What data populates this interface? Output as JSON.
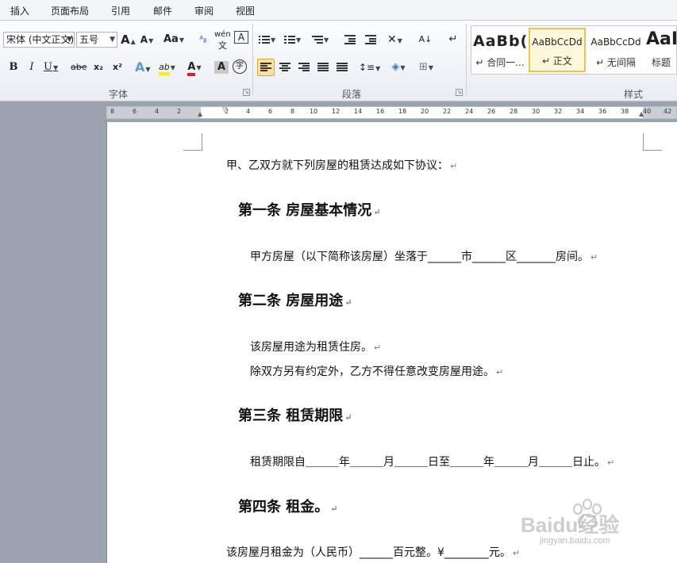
{
  "menu": {
    "tabs": [
      "插入",
      "页面布局",
      "引用",
      "邮件",
      "审阅",
      "视图"
    ]
  },
  "font_group": {
    "font_name": "宋体 (中文正文)",
    "font_size": "五号",
    "grow": "A",
    "shrink": "A",
    "change_case": "Aa",
    "phonetic": "wén",
    "border_char": "A",
    "bold": "B",
    "italic": "I",
    "underline": "U",
    "strike": "abe",
    "subscript": "x₂",
    "superscript": "x²",
    "effects": "A",
    "highlight": "ab",
    "font_color": "A",
    "char_shading": "A",
    "enclose": "字",
    "label": "字体"
  },
  "paragraph_group": {
    "label": "段落"
  },
  "styles_group": {
    "label": "样式",
    "items": [
      {
        "sample": "AaBb(",
        "name": "↵ 合同一..."
      },
      {
        "sample": "AaBbCcDd",
        "name": "↵ 正文"
      },
      {
        "sample": "AaBbCcDd",
        "name": "↵ 无间隔"
      },
      {
        "sample": "AaI",
        "name": "标题"
      }
    ]
  },
  "ruler": {
    "ticks": [
      "8",
      "6",
      "4",
      "2",
      "2",
      "4",
      "6",
      "8",
      "10",
      "12",
      "14",
      "16",
      "18",
      "20",
      "22",
      "24",
      "26",
      "28",
      "30",
      "32",
      "34",
      "36",
      "38",
      "40",
      "42"
    ]
  },
  "document": {
    "intro": "甲、乙双方就下列房屋的租赁达成如下协议：",
    "article1_title": "第一条 房屋基本情况",
    "article1_text": "甲方房屋（以下简称该房屋）坐落于______市______区_______房间。",
    "article2_title": "第二条 房屋用途",
    "article2_text1": "该房屋用途为租赁住房。",
    "article2_text2": "除双方另有约定外，乙方不得任意改变房屋用途。",
    "article3_title": "第三条 租赁期限",
    "article3_text": "租赁期限自＿＿＿年＿＿＿月＿＿＿日至＿＿＿年＿＿＿月＿＿＿日止。",
    "article4_title": "第四条 租金。",
    "article4_text": "该房屋月租金为（人民币）______百元整。¥________元。",
    "para_mark": "↵"
  },
  "watermark": {
    "brand": "Baidu经验",
    "url": "jingyan.baidu.com"
  },
  "colors": {
    "ribbon_bg": "#eef1f5",
    "active_button": "#fbe29b",
    "selected_style_border": "#f1c14c",
    "font_color_red": "#e02020",
    "highlight_yellow": "#ffee00"
  }
}
